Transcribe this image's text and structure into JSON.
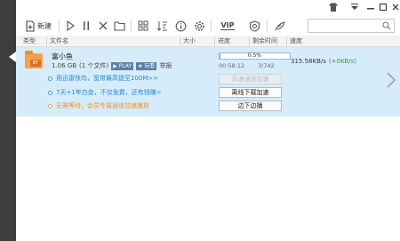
{
  "titlebar": {
    "icons": [
      "shirt-icon",
      "menu-icon",
      "minimize-icon",
      "maximize-icon",
      "close-icon"
    ]
  },
  "toolbar": {
    "new_label": "新建",
    "icons": [
      "new-task-icon",
      "play-icon",
      "pause-icon",
      "delete-icon",
      "open-folder-icon",
      "grid-view-icon",
      "sort-list-icon",
      "info-icon",
      "settings-icon",
      "vip-icon",
      "skin-icon",
      "feedback-icon"
    ],
    "vip_label": "VIP"
  },
  "search": {
    "placeholder": ""
  },
  "columns": [
    "类型",
    "文件名",
    "大小",
    "进度",
    "剩余时间",
    "速度"
  ],
  "task": {
    "file_name": "富小鱼",
    "size": "1.06 GB",
    "file_count": "(1 个文件)",
    "play_tag": "PLAY",
    "star_tag": "玩看",
    "report": "举报",
    "progress_percent": 0.5,
    "progress_label": "0.5%",
    "time_remaining": "00:58:12",
    "pieces": "3/742",
    "speed": "315.58KB/s",
    "speed_delta": "(+0KB/s)",
    "hints": [
      {
        "text": "用迅雷快鸟，宽带最高提至100M>>",
        "color": "blue"
      },
      {
        "text": "7天+1年白金，不仅免费，还有钱赚>",
        "color": "blue"
      },
      {
        "text": "无需等待，会员专属通道加速播放",
        "color": "orange"
      }
    ],
    "buttons": {
      "channel": "高速通道加速",
      "offline": "离线下载加速",
      "stream": "边下边播"
    }
  },
  "colors": {
    "sidebar": "#3d3d3d",
    "row_selected": "#d6ecfb",
    "link_blue": "#1f8ad6",
    "accent_orange": "#e8952a",
    "speed_green": "#29a329"
  }
}
